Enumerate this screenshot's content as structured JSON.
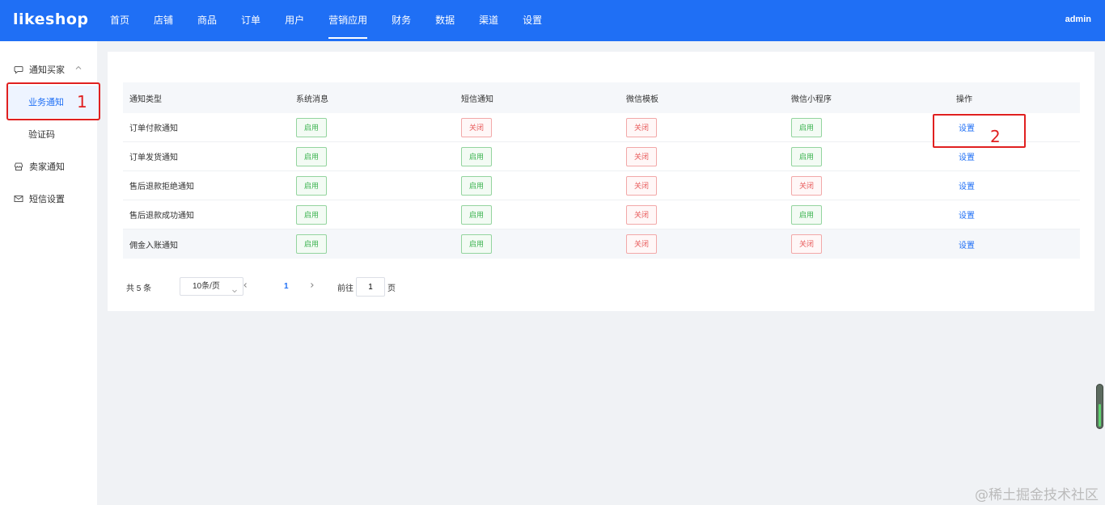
{
  "app": {
    "logo": "likeshop",
    "user": "admin"
  },
  "nav": [
    "首页",
    "店铺",
    "商品",
    "订单",
    "用户",
    "营销应用",
    "财务",
    "数据",
    "渠道",
    "设置"
  ],
  "nav_active": "营销应用",
  "sidebar": {
    "group1": "通知买家",
    "sub1": "业务通知",
    "sub2": "验证码",
    "group2": "卖家通知",
    "group3": "短信设置"
  },
  "annotations": {
    "box1": "1",
    "box2": "2"
  },
  "table": {
    "headers": [
      "通知类型",
      "系统消息",
      "短信通知",
      "微信模板",
      "微信小程序",
      "操作"
    ],
    "rows": [
      {
        "name": "订单付款通知",
        "system": "启用",
        "sms": "关闭",
        "wechat": "关闭",
        "mini": "启用",
        "op": "设置"
      },
      {
        "name": "订单发货通知",
        "system": "启用",
        "sms": "启用",
        "wechat": "关闭",
        "mini": "启用",
        "op": "设置"
      },
      {
        "name": "售后退款拒绝通知",
        "system": "启用",
        "sms": "启用",
        "wechat": "关闭",
        "mini": "关闭",
        "op": "设置"
      },
      {
        "name": "售后退款成功通知",
        "system": "启用",
        "sms": "启用",
        "wechat": "关闭",
        "mini": "启用",
        "op": "设置"
      },
      {
        "name": "佣金入账通知",
        "system": "启用",
        "sms": "启用",
        "wechat": "关闭",
        "mini": "关闭",
        "op": "设置"
      }
    ]
  },
  "pagination": {
    "total": "共 5 条",
    "page_size": "10条/页",
    "current": "1",
    "goto_label": "前往",
    "goto_value": "1",
    "page_suffix": "页"
  },
  "watermark": "@稀土掘金技术社区",
  "colors": {
    "brand": "#1f6ff5",
    "on": "#3bb34f",
    "off": "#e85a5a",
    "annotation": "#e02020"
  }
}
